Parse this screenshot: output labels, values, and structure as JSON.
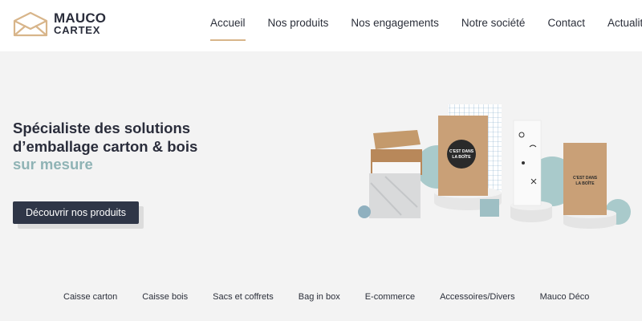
{
  "brand": {
    "line1": "MAUCO",
    "line2": "CARTEX",
    "logo_icon": "envelope-house-icon",
    "accent_color": "#d8b58a"
  },
  "nav": {
    "items": [
      {
        "label": "Accueil",
        "active": true
      },
      {
        "label": "Nos produits"
      },
      {
        "label": "Nos engagements"
      },
      {
        "label": "Notre société"
      },
      {
        "label": "Contact"
      },
      {
        "label": "Actualités"
      }
    ]
  },
  "hero": {
    "title_line1": "Spécialiste des solutions",
    "title_line2": "d’emballage carton & bois",
    "title_accent": "sur mesure",
    "accent_color": "#8fb3b5",
    "cta_label": "Découvrir nos produits",
    "cta_color": "#2f3647",
    "box_label_1a": "C'EST DANS",
    "box_label_1b": "LA BOÎTE",
    "box_label_2a": "C'EST DANS",
    "box_label_2b": "LA BOÎTE"
  },
  "categories": [
    "Caisse carton",
    "Caisse bois",
    "Sacs et coffrets",
    "Bag in box",
    "E-commerce",
    "Accessoires/Divers",
    "Mauco Déco"
  ]
}
